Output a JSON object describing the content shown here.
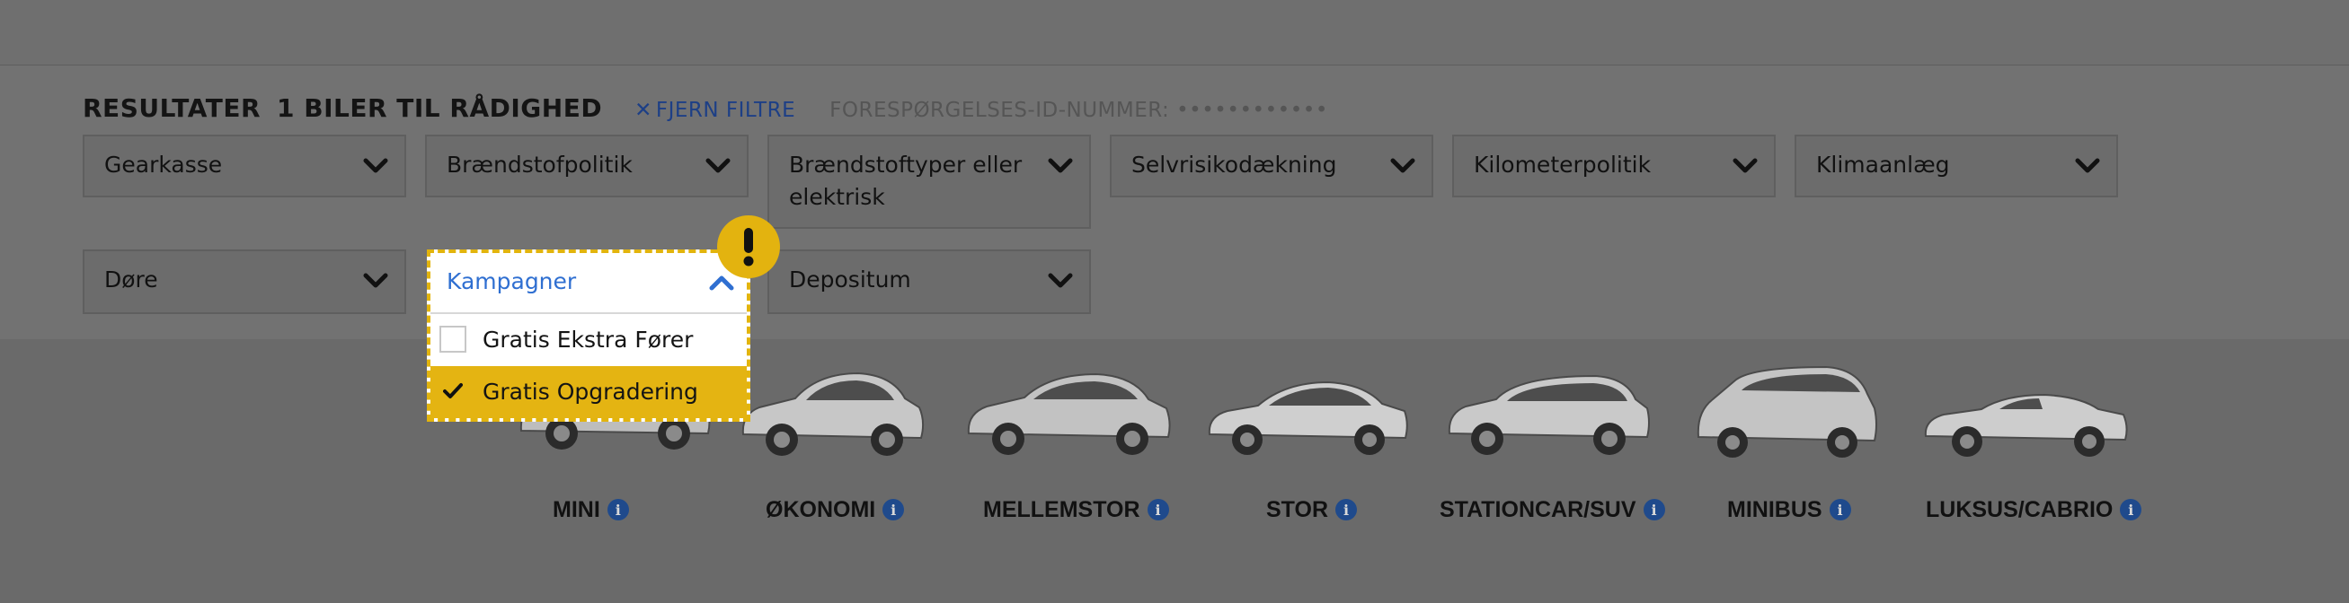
{
  "results": {
    "title": "RESULTATER",
    "count_text": "1 BILER TIL RÅDIGHED",
    "clear_filters_label": "FJERN FILTRE",
    "clear_filters_icon": "close-icon",
    "request_id_label": "FORESPØRGELSES-ID-NUMMER: ••••••••••••"
  },
  "filters": [
    {
      "label": "Gearkasse"
    },
    {
      "label": "Brændstofpolitik"
    },
    {
      "label": "Brændstoftyper eller elektrisk"
    },
    {
      "label": "Selvrisikodækning"
    },
    {
      "label": "Kilometerpolitik"
    },
    {
      "label": "Klimaanlæg"
    },
    {
      "label": "Døre"
    },
    {
      "label": "Kampagner"
    },
    {
      "label": "Depositum"
    }
  ],
  "open_dropdown": {
    "label": "Kampagner",
    "options": [
      {
        "label": "Gratis Ekstra Fører",
        "checked": false
      },
      {
        "label": "Gratis Opgradering",
        "checked": true
      }
    ]
  },
  "warning_badge": {
    "symbol": "!"
  },
  "categories": [
    {
      "name": "MINI",
      "info": "i"
    },
    {
      "name": "ØKONOMI",
      "info": "i"
    },
    {
      "name": "MELLEMSTOR",
      "info": "i"
    },
    {
      "name": "STOR",
      "info": "i"
    },
    {
      "name": "STATIONCAR/SUV",
      "info": "i"
    },
    {
      "name": "MINIBUS",
      "info": "i"
    },
    {
      "name": "LUKSUS/CABRIO",
      "info": "i"
    }
  ],
  "colors": {
    "accent_yellow": "#e4b412",
    "link_blue": "#1d3f86",
    "dropdown_label_blue": "#2f6fd1",
    "info_blue": "#1f4a8c"
  }
}
